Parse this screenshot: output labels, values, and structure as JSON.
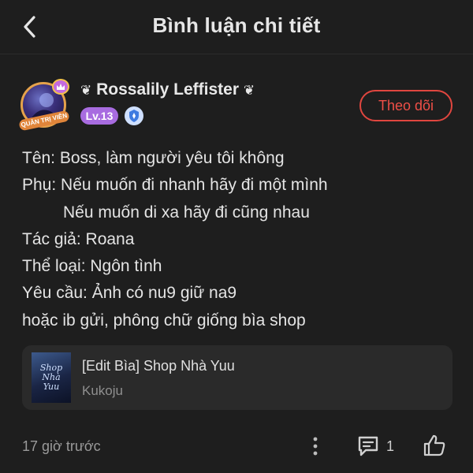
{
  "header": {
    "title": "Bình luận chi tiết",
    "back_icon": "chevron-left-icon"
  },
  "author": {
    "name": "Rossalily Leffister",
    "name_ornament": "flower-icon",
    "level": "Lv.13",
    "badge_text": "QUẢN TRỊ VIÊN",
    "follow_label": "Theo dõi",
    "follow_color": "#e0463f",
    "level_color": "#a86ce0"
  },
  "post": {
    "lines": [
      "Tên: Boss, làm người yêu tôi không",
      "Phụ: Nếu muốn đi nhanh hãy đi một mình",
      "Nếu muốn di xa hãy đi cũng nhau",
      "Tác giả: Roana",
      "Thể loại: Ngôn tình",
      "Yêu cầu: Ảnh có nu9 giữ na9",
      "hoặc ib gửi, phông chữ giống bìa shop"
    ]
  },
  "linked": {
    "title": "[Edit Bìa] Shop Nhà Yuu",
    "author": "Kukoju",
    "cover_text": "Shop Nhà Yuu"
  },
  "footer": {
    "time": "17 giờ trước",
    "comment_count": "1",
    "icons": [
      "more-vertical-icon",
      "comment-icon",
      "thumbs-up-icon"
    ]
  }
}
